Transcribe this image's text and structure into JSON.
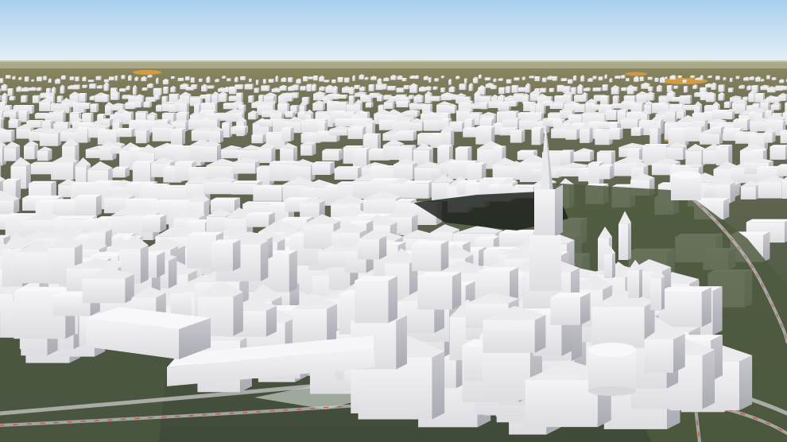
{
  "scene": {
    "description_type": "3d-city-model-aerial-view",
    "colors": {
      "sky_top": "#a9cfee",
      "sky_bottom": "#e6f0f6",
      "horizon": "#8f8a63",
      "ground_dark": "#3f4a38",
      "ground_mid": "#56604a",
      "building_light": "#f1f1f3",
      "building_mid": "#dcdce0",
      "building_shadow": "#b7b8bf",
      "road": "#c9c9c9",
      "road_marking": "#d64a4a",
      "orange_highlight": "#e8a23a",
      "plaza": "#a8b1a6",
      "brown_field": "#6e4a3c"
    }
  },
  "labels": {
    "road_1": "",
    "road_2": "",
    "road_3": ""
  }
}
